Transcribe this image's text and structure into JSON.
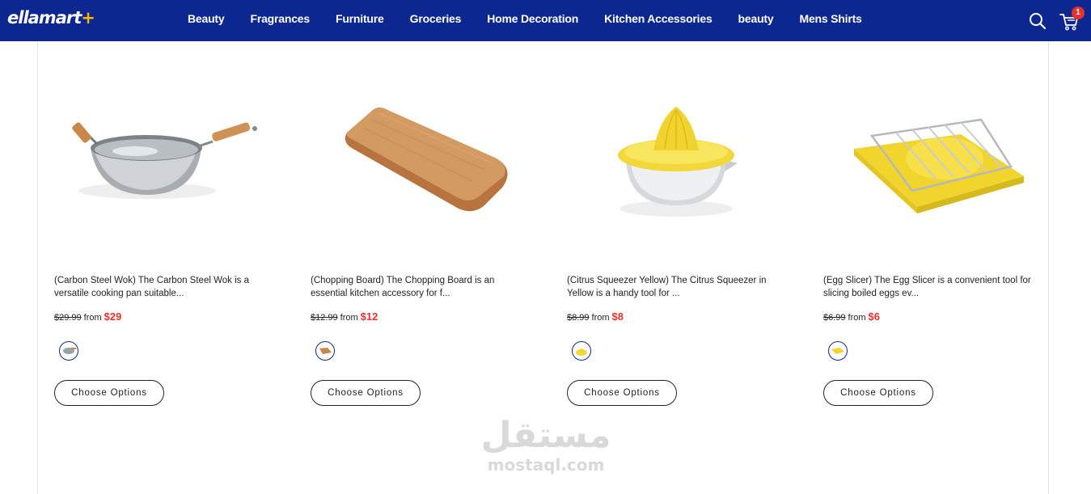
{
  "header": {
    "logo_main": "ellamart",
    "logo_accent": "+",
    "nav": [
      "Beauty",
      "Fragrances",
      "Furniture",
      "Groceries",
      "Home Decoration",
      "Kitchen Accessories",
      "beauty",
      "Mens Shirts"
    ],
    "cart_count": "1",
    "icons": {
      "search": "search-icon",
      "cart": "cart-icon"
    },
    "colors": {
      "brand": "#0c2790",
      "accent": "#ffb400",
      "badge": "#e8322b"
    }
  },
  "products": [
    {
      "title": "(Carbon Steel Wok) The Carbon Steel Wok is a versatile cooking pan suitable...",
      "old_price": "$29.99",
      "from_label": "from",
      "price": "$29",
      "button": "Choose Options",
      "image": "wok-image"
    },
    {
      "title": "(Chopping Board) The Chopping Board is an essential kitchen accessory for f...",
      "old_price": "$12.99",
      "from_label": "from",
      "price": "$12",
      "button": "Choose Options",
      "image": "chopping-board-image"
    },
    {
      "title": "(Citrus Squeezer Yellow) The Citrus Squeezer in Yellow is a handy tool for ...",
      "old_price": "$8.99",
      "from_label": "from",
      "price": "$8",
      "button": "Choose Options",
      "image": "citrus-squeezer-image"
    },
    {
      "title": "(Egg Slicer) The Egg Slicer is a convenient tool for slicing boiled eggs ev...",
      "old_price": "$6.99",
      "from_label": "from",
      "price": "$6",
      "button": "Choose Options",
      "image": "egg-slicer-image"
    }
  ],
  "watermark": {
    "arabic": "مستقل",
    "latin": "mostaql.com"
  },
  "price_color": "#e8322b"
}
